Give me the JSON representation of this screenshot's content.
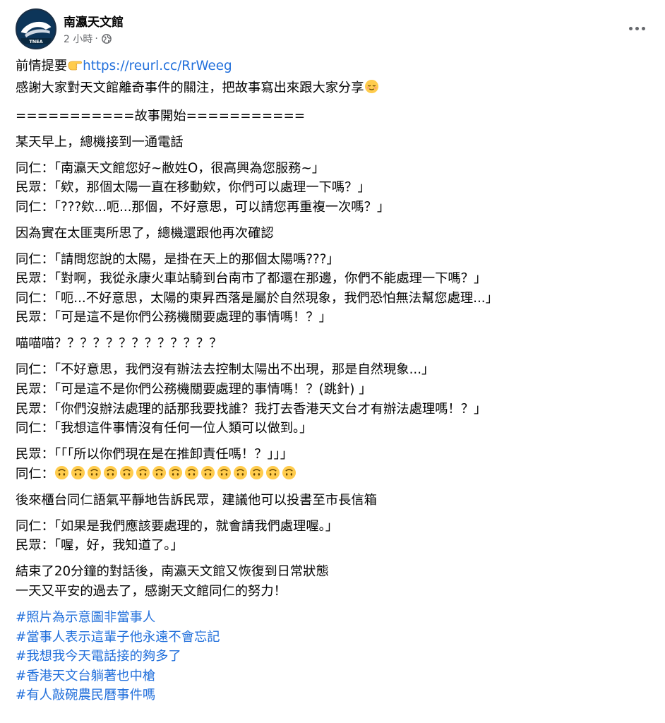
{
  "header": {
    "page_name": "南瀛天文館",
    "time": "2 小時",
    "separator": "·",
    "avatar_text": "TNEA",
    "privacy_icon": "globe-icon",
    "more_icon": "more-dots-icon"
  },
  "intro": {
    "prefix": "前情提要",
    "pointer_emoji": "👉",
    "link": "https://reurl.cc/RrWeeg",
    "line2": "感謝大家對天文館離奇事件的關注，把故事寫出來跟大家分享",
    "smile_emoji": "😌"
  },
  "divider": "===========故事開始===========",
  "story": [
    [
      "某天早上，總機接到一通電話"
    ],
    [
      "同仁：「南瀛天文館您好~敝姓O，很高興為您服務~」",
      "民眾：「欸，那個太陽一直在移動欸，你們可以處理一下嗎？」",
      "同仁：「???欸...呃...那個，不好意思，可以請您再重複一次嗎？」"
    ],
    [
      "因為實在太匪夷所思了，總機還跟他再次確認"
    ],
    [
      "同仁：「請問您說的太陽，是掛在天上的那個太陽嗎???」",
      "民眾：「對啊，我從永康火車站騎到台南市了都還在那邊，你們不能處理一下嗎？」",
      "同仁：「呃...不好意思，太陽的東昇西落是屬於自然現象，我們恐怕無法幫您處理...」",
      "民眾：「可是這不是你們公務機關要處理的事情嗎！？」"
    ],
    [
      "喵喵喵？？？？？？？？？？？？？"
    ],
    [
      "同仁：「不好意思，我們沒有辦法去控制太陽出不出現，那是自然現象...」",
      "民眾：「可是這不是你們公務機關要處理的事情嗎！？(跳針) 」",
      "民眾：「你們沒辦法處理的話那我要找誰？我打去香港天文台才有辦法處理嗎！？」",
      "同仁：「我想這件事情沒有任何一位人類可以做到。」"
    ]
  ],
  "argument": {
    "line1": "民眾：「「「所以你們現在是在推卸責任嗎！？」」」",
    "line2_prefix": "同仁：",
    "upside_down_emoji": "🙃",
    "upside_down_count": 15
  },
  "ending": [
    [
      "後來櫃台同仁語氣平靜地告訴民眾，建議他可以投書至市長信箱"
    ],
    [
      "同仁：「如果是我們應該要處理的，就會請我們處理喔。」",
      "民眾：「喔，好，我知道了。」"
    ],
    [
      "結束了20分鐘的對話後，南瀛天文館又恢復到日常狀態",
      "一天又平安的過去了，感謝天文館同仁的努力！"
    ]
  ],
  "hashtags": [
    "#照片為示意圖非當事人",
    "#當事人表示這輩子他永遠不會忘記",
    "#我想我今天電話接的夠多了",
    "#香港天文台躺著也中槍",
    "#有人敲碗農民曆事件嗎"
  ],
  "colors": {
    "text": "#050505",
    "secondary": "#65676b",
    "link": "#216fdb",
    "avatar_bg": "#0d3559",
    "emoji_yellow": "#ffcc4d"
  }
}
